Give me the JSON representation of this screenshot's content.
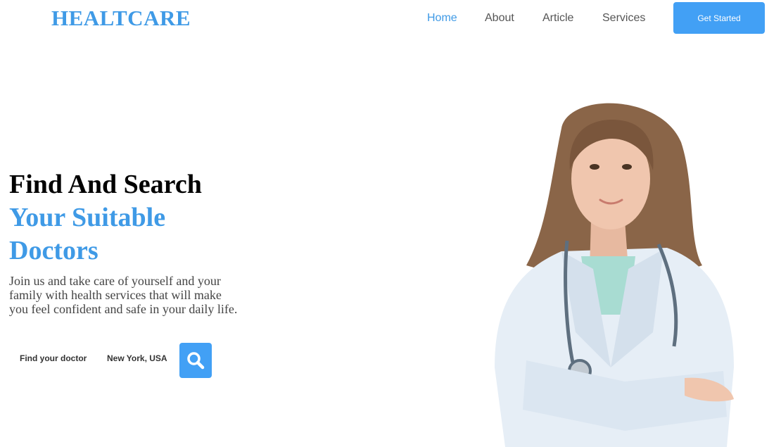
{
  "brand": {
    "logo": "HEALTCARE"
  },
  "nav": {
    "items": [
      {
        "label": "Home",
        "active": true
      },
      {
        "label": "About"
      },
      {
        "label": "Article"
      },
      {
        "label": "Services"
      }
    ],
    "cta_label": "Get Started"
  },
  "hero": {
    "title_line1": "Find And Search",
    "title_line2": "Your Suitable",
    "title_line3": "Doctors",
    "description": "Join us and take care of yourself and your family with health services that will make you feel confident and safe in your daily life."
  },
  "search": {
    "find_label": "Find your doctor",
    "location_label": "New York, USA",
    "button_icon": "search-icon"
  },
  "image": {
    "subject": "doctor-illustration"
  },
  "colors": {
    "accent": "#42a0f5",
    "logo": "#3f9ae6"
  }
}
